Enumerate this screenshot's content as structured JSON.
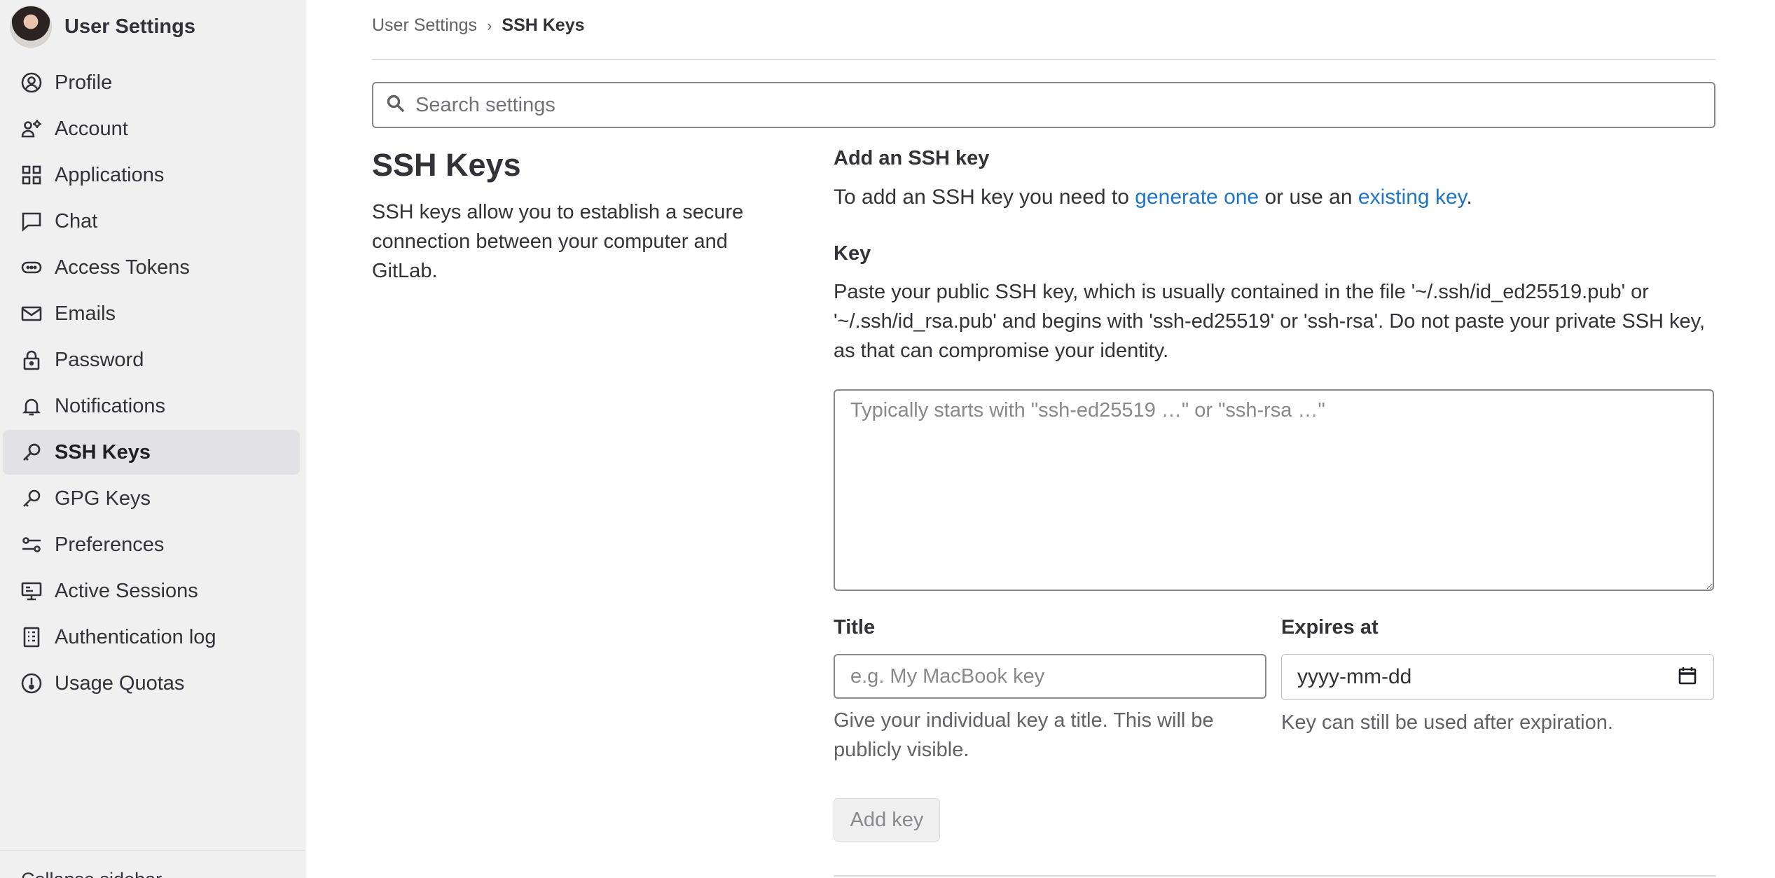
{
  "sidebar": {
    "title": "User Settings",
    "items": [
      {
        "label": "Profile",
        "icon": "profile-icon"
      },
      {
        "label": "Account",
        "icon": "account-icon"
      },
      {
        "label": "Applications",
        "icon": "applications-icon"
      },
      {
        "label": "Chat",
        "icon": "chat-icon"
      },
      {
        "label": "Access Tokens",
        "icon": "token-icon"
      },
      {
        "label": "Emails",
        "icon": "mail-icon"
      },
      {
        "label": "Password",
        "icon": "lock-icon"
      },
      {
        "label": "Notifications",
        "icon": "bell-icon"
      },
      {
        "label": "SSH Keys",
        "icon": "key-icon",
        "active": true
      },
      {
        "label": "GPG Keys",
        "icon": "key-icon"
      },
      {
        "label": "Preferences",
        "icon": "preferences-icon"
      },
      {
        "label": "Active Sessions",
        "icon": "monitor-icon"
      },
      {
        "label": "Authentication log",
        "icon": "log-icon"
      },
      {
        "label": "Usage Quotas",
        "icon": "quota-icon"
      }
    ],
    "collapse_label": "Collapse sidebar"
  },
  "breadcrumb": {
    "parent": "User Settings",
    "separator": "›",
    "current": "SSH Keys"
  },
  "search": {
    "placeholder": "Search settings"
  },
  "section": {
    "title": "SSH Keys",
    "description": "SSH keys allow you to establish a secure connection between your computer and GitLab."
  },
  "form": {
    "heading": "Add an SSH key",
    "intro_prefix": "To add an SSH key you need to ",
    "generate_link": "generate one",
    "intro_middle": " or use an ",
    "existing_link": "existing key",
    "intro_suffix": ".",
    "key_label": "Key",
    "key_help": "Paste your public SSH key, which is usually contained in the file '~/.ssh/id_ed25519.pub' or '~/.ssh/id_rsa.pub' and begins with 'ssh-ed25519' or 'ssh-rsa'. Do not paste your private SSH key, as that can compromise your identity.",
    "key_placeholder": "Typically starts with \"ssh-ed25519 …\" or \"ssh-rsa …\"",
    "title_label": "Title",
    "title_placeholder": "e.g. My MacBook key",
    "title_help": "Give your individual key a title. This will be publicly visible.",
    "expires_label": "Expires at",
    "expires_value": "yyyy-mm-dd",
    "expires_help": "Key can still be used after expiration.",
    "submit_label": "Add key"
  },
  "colors": {
    "link": "#1f75cb",
    "sidebar_bg": "#f0f0f0",
    "active_item_bg": "#e2e2e6"
  }
}
